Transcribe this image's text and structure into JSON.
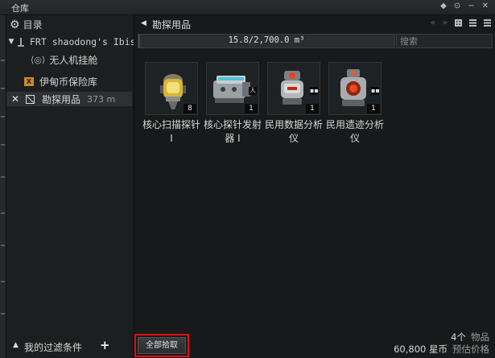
{
  "window": {
    "title": "仓库",
    "icons": [
      "diamond-icon",
      "target-icon",
      "minimize-icon",
      "close-icon"
    ]
  },
  "sidebar": {
    "header_label": "目录",
    "items": [
      {
        "label": "FRT shaodong's Ibis",
        "icon": "ship-icon",
        "expanded": true
      },
      {
        "label": "无人机挂舱",
        "icon": "drone-bay-icon"
      },
      {
        "label": "伊甸币保险库",
        "icon": "vault-icon"
      },
      {
        "label": "勘探用品",
        "distance": "373 m",
        "icon": "filter-icon",
        "selected": true
      }
    ],
    "footer": {
      "filter_label": "我的过滤条件",
      "add_label": "+"
    }
  },
  "main": {
    "title": "勘探用品",
    "capacity": {
      "text": "15.8/2,700.0 m³",
      "used": 15.8,
      "total": 2700.0
    },
    "search": {
      "placeholder": "搜索"
    },
    "items": [
      {
        "name": "核心扫描探针 I",
        "quantity": "8",
        "icon": "core-scanner-probe-icon"
      },
      {
        "name": "核心探针发射器 I",
        "quantity": "1",
        "icon": "probe-launcher-icon",
        "skill_badge": true
      },
      {
        "name": "民用数据分析仪",
        "quantity": "1",
        "icon": "data-analyzer-icon"
      },
      {
        "name": "民用遗迹分析仪",
        "quantity": "1",
        "icon": "relic-analyzer-icon"
      }
    ],
    "loot_all_label": "全部拾取",
    "stats": {
      "count": "4个",
      "count_label": "物品",
      "value": "60,800 星币",
      "value_label": "预估价格"
    }
  },
  "colors": {
    "alert_outline": "#e01010",
    "vault_orange": "#c9892a",
    "capacity_fill": "#3d5058"
  }
}
